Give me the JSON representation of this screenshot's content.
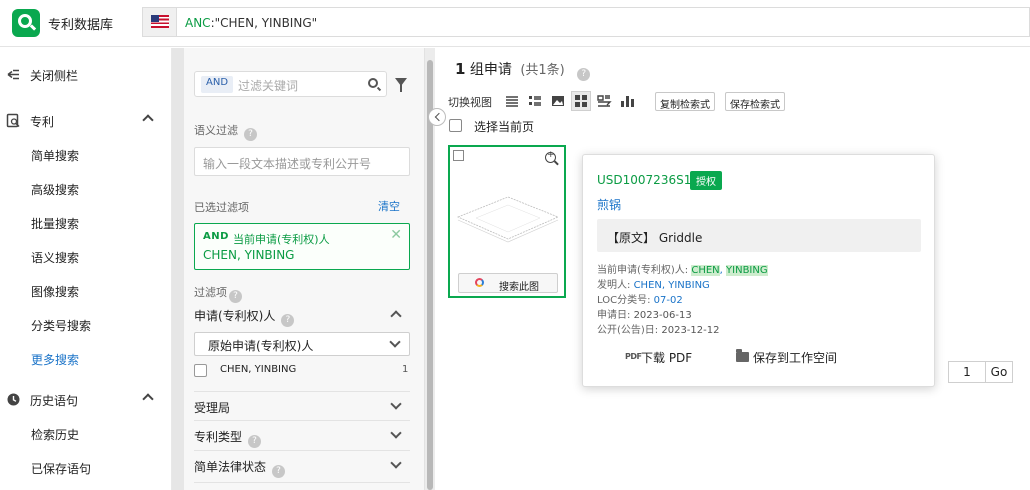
{
  "app": {
    "title": "专利数据库"
  },
  "query": {
    "field": "ANC",
    "value": ":\"CHEN, YINBING\""
  },
  "sidebar": {
    "close_label": "关闭侧栏",
    "patent_section": {
      "label": "专利"
    },
    "items": [
      {
        "label": "简单搜索"
      },
      {
        "label": "高级搜索"
      },
      {
        "label": "批量搜索"
      },
      {
        "label": "语义搜索"
      },
      {
        "label": "图像搜索"
      },
      {
        "label": "分类号搜索"
      },
      {
        "label": "更多搜索"
      }
    ],
    "history_section": {
      "label": "历史语句"
    },
    "history_items": [
      {
        "label": "检索历史"
      },
      {
        "label": "已保存语句"
      }
    ]
  },
  "filter_panel": {
    "keyword": {
      "operator": "AND",
      "placeholder": "过滤关键词"
    },
    "semantic_title": "语义过滤",
    "semantic_placeholder": "输入一段文本描述或专利公开号",
    "selected_title": "已选过滤项",
    "clear_label": "清空",
    "selected": {
      "operator": "AND",
      "field": "当前申请(专利权)人",
      "value": "CHEN, YINBING"
    },
    "filters_title": "过滤项",
    "applicant_section": "申请(专利权)人",
    "applicant_select": "原始申请(专利权)人",
    "options": [
      {
        "label": "CHEN, YINBING",
        "count": "1"
      }
    ],
    "sections": [
      {
        "label": "受理局"
      },
      {
        "label": "专利类型"
      },
      {
        "label": "简单法律状态"
      }
    ]
  },
  "results": {
    "count": "1",
    "count_unit": "组申请",
    "total": "(共1条)",
    "view_label": "切换视图",
    "copy_query_label": "复制检索式",
    "save_query_label": "保存检索式",
    "select_page_label": "选择当前页",
    "image_search_label": "搜索此图"
  },
  "popup": {
    "pub_no": "USD1007236S1",
    "status": "授权",
    "title_cn": "煎锅",
    "original_prefix": "【原文】",
    "original_title": "Griddle",
    "applicant_label": "当前申请(专利权)人:",
    "applicant_part1": "CHEN",
    "applicant_sep": ", ",
    "applicant_part2": "YINBING",
    "inventor_label": "发明人:",
    "inventor_value": "CHEN, YINBING",
    "loc_label": "LOC分类号:",
    "loc_value": "07-02",
    "app_date_label": "申请日:",
    "app_date_value": "2023-06-13",
    "pub_date_label": "公开(公告)日:",
    "pub_date_value": "2023-12-12",
    "download_pdf_label": "下载 PDF",
    "save_ws_label": "保存到工作空间",
    "pdf_icon_text": "PDF"
  },
  "pagination": {
    "page": "1",
    "go_label": "Go"
  },
  "colors": {
    "accent_green": "#0aa84f",
    "link_blue": "#1a73c8"
  }
}
